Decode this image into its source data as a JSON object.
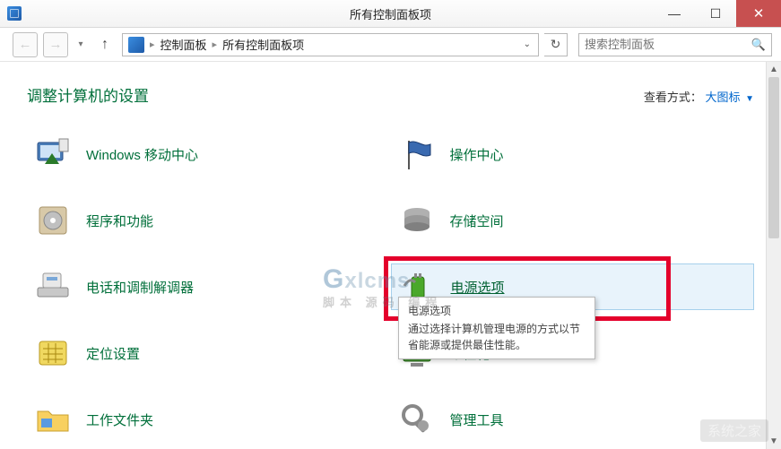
{
  "window": {
    "title": "所有控制面板项"
  },
  "nav": {
    "breadcrumb": [
      "控制面板",
      "所有控制面板项"
    ],
    "search_placeholder": "搜索控制面板"
  },
  "heading": "调整计算机的设置",
  "viewmode": {
    "label": "查看方式：",
    "value": "大图标"
  },
  "items_left": [
    {
      "label": "Windows 移动中心",
      "icon": "mobility"
    },
    {
      "label": "程序和功能",
      "icon": "programs"
    },
    {
      "label": "电话和调制解调器",
      "icon": "phone"
    },
    {
      "label": "定位设置",
      "icon": "location"
    },
    {
      "label": "工作文件夹",
      "icon": "folder"
    }
  ],
  "items_right": [
    {
      "label": "操作中心",
      "icon": "flag"
    },
    {
      "label": "存储空间",
      "icon": "storage"
    },
    {
      "label": "电源选项",
      "icon": "power",
      "highlighted": true
    },
    {
      "label": "个性化",
      "icon": "personalize"
    },
    {
      "label": "管理工具",
      "icon": "admin"
    }
  ],
  "tooltip": {
    "title": "电源选项",
    "body": "通过选择计算机管理电源的方式以节省能源或提供最佳性能。"
  },
  "watermark": {
    "main": "xlcms",
    "sub": "脚本 源码 编程"
  },
  "watermark2": "系统之家"
}
